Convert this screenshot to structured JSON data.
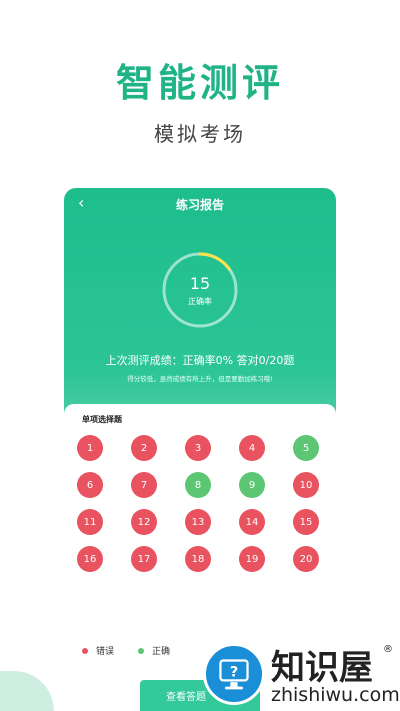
{
  "hero": {
    "title": "智能测评",
    "subtitle": "模拟考场"
  },
  "phone": {
    "back_icon": "chevron-left-icon",
    "title": "练习报告",
    "gauge": {
      "value": "15",
      "label": "正确率",
      "progress": 0.15,
      "color": "#ffe14d"
    },
    "summary": "上次测评成绩：正确率0% 答对0/20题",
    "tip": "得分较低，虽然成绩有所上升，但是要勤加练习哦!",
    "section_title": "单项选择题",
    "questions": [
      {
        "n": "1",
        "status": "wrong"
      },
      {
        "n": "2",
        "status": "wrong"
      },
      {
        "n": "3",
        "status": "wrong"
      },
      {
        "n": "4",
        "status": "wrong"
      },
      {
        "n": "5",
        "status": "right"
      },
      {
        "n": "6",
        "status": "wrong"
      },
      {
        "n": "7",
        "status": "wrong"
      },
      {
        "n": "8",
        "status": "right"
      },
      {
        "n": "9",
        "status": "right"
      },
      {
        "n": "10",
        "status": "wrong"
      },
      {
        "n": "11",
        "status": "wrong"
      },
      {
        "n": "12",
        "status": "wrong"
      },
      {
        "n": "13",
        "status": "wrong"
      },
      {
        "n": "14",
        "status": "wrong"
      },
      {
        "n": "15",
        "status": "wrong"
      },
      {
        "n": "16",
        "status": "wrong"
      },
      {
        "n": "17",
        "status": "wrong"
      },
      {
        "n": "18",
        "status": "wrong"
      },
      {
        "n": "19",
        "status": "wrong"
      },
      {
        "n": "20",
        "status": "wrong"
      }
    ],
    "legend": {
      "wrong": "错误",
      "right": "正确"
    },
    "view_button": "查看答题"
  },
  "watermark": {
    "name": "知识屋",
    "registered": "®",
    "domain": "zhishiwu.com",
    "icon": "monitor-question-icon"
  },
  "colors": {
    "accent": "#1fb386",
    "wrong": "#e9525f",
    "right": "#5cc673"
  }
}
